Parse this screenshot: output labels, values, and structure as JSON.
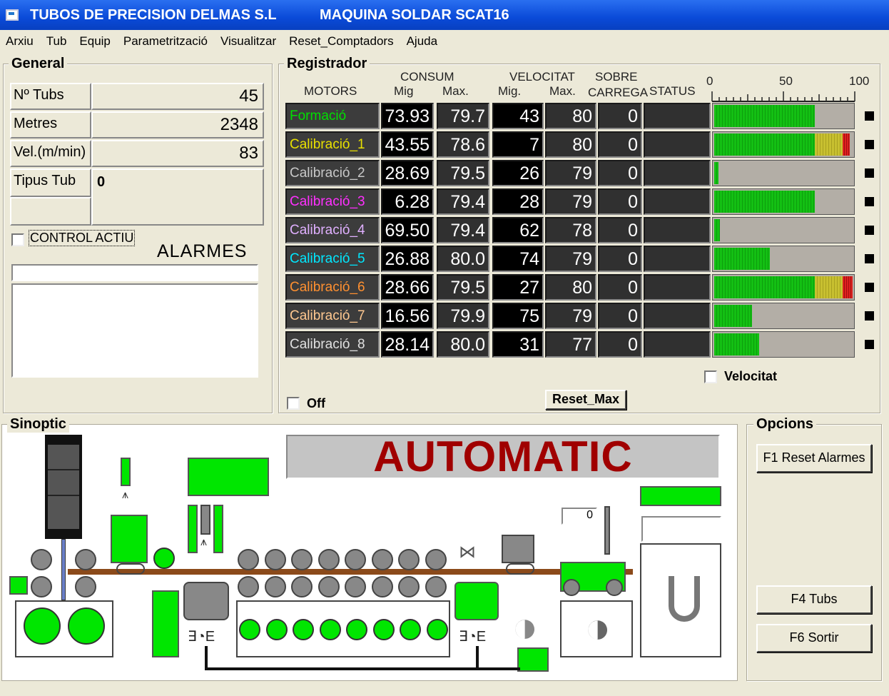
{
  "window": {
    "company": "TUBOS  DE PRECISION DELMAS S.L",
    "machine": "MAQUINA SOLDAR SCAT16"
  },
  "menu": [
    "Arxiu",
    "Tub",
    "Equip",
    "Parametrització",
    "Visualitzar",
    "Reset_Comptadors",
    "Ajuda"
  ],
  "general": {
    "legend": "General",
    "rows": [
      {
        "label": "Nº Tubs",
        "value": "45"
      },
      {
        "label": "Metres",
        "value": "2348"
      },
      {
        "label": "Vel.(m/min)",
        "value": "83"
      },
      {
        "label": "Tipus Tub",
        "value": "0"
      }
    ],
    "control_label": "CONTROL ACTIU",
    "alarms_title": "ALARMES"
  },
  "registrador": {
    "legend": "Registrador",
    "headers": {
      "motors": "MOTORS",
      "consum": "CONSUM",
      "consum_mig": "Mig",
      "consum_max": "Max.",
      "velocitat": "VELOCITAT",
      "vel_mig": "Mig.",
      "vel_max": "Max.",
      "sobre": "SOBRE",
      "carrega": "CARREGA",
      "status": "STATUS",
      "scale_0": "0",
      "scale_50": "50",
      "scale_100": "100"
    },
    "motors": [
      {
        "name": "Formació",
        "color": "#00e000",
        "consum_mig": "73.93",
        "consum_max": "79.7",
        "vel_mig": "43",
        "vel_max": "80",
        "sobre": "0",
        "load": 72,
        "yellow": 0,
        "red": 0
      },
      {
        "name": "Calibració_1",
        "color": "#e8e000",
        "consum_mig": "43.55",
        "consum_max": "78.6",
        "vel_mig": "7",
        "vel_max": "80",
        "sobre": "0",
        "load": 72,
        "yellow": 20,
        "red": 5
      },
      {
        "name": "Calibració_2",
        "color": "#c8c8c8",
        "consum_mig": "28.69",
        "consum_max": "79.5",
        "vel_mig": "26",
        "vel_max": "79",
        "sobre": "0",
        "load": 3,
        "yellow": 0,
        "red": 0
      },
      {
        "name": "Calibració_3",
        "color": "#ff30ff",
        "consum_mig": "6.28",
        "consum_max": "79.4",
        "vel_mig": "28",
        "vel_max": "79",
        "sobre": "0",
        "load": 72,
        "yellow": 0,
        "red": 0
      },
      {
        "name": "Calibració_4",
        "color": "#e0b0ff",
        "consum_mig": "69.50",
        "consum_max": "79.4",
        "vel_mig": "62",
        "vel_max": "78",
        "sobre": "0",
        "load": 4,
        "yellow": 0,
        "red": 0
      },
      {
        "name": "Calibració_5",
        "color": "#00e8ff",
        "consum_mig": "26.88",
        "consum_max": "80.0",
        "vel_mig": "74",
        "vel_max": "79",
        "sobre": "0",
        "load": 40,
        "yellow": 0,
        "red": 0
      },
      {
        "name": "Calibració_6",
        "color": "#ff9030",
        "consum_mig": "28.66",
        "consum_max": "79.5",
        "vel_mig": "27",
        "vel_max": "80",
        "sobre": "0",
        "load": 72,
        "yellow": 20,
        "red": 7
      },
      {
        "name": "Calibració_7",
        "color": "#ffc890",
        "consum_mig": "16.56",
        "consum_max": "79.9",
        "vel_mig": "75",
        "vel_max": "79",
        "sobre": "0",
        "load": 27,
        "yellow": 0,
        "red": 0
      },
      {
        "name": "Calibració_8",
        "color": "#e0e0e0",
        "consum_mig": "28.14",
        "consum_max": "80.0",
        "vel_mig": "31",
        "vel_max": "77",
        "sobre": "0",
        "load": 32,
        "yellow": 0,
        "red": 0
      }
    ],
    "velocitat_label": "Velocitat",
    "off_label": "Off",
    "reset_max": "Reset_Max"
  },
  "sinoptic": {
    "legend": "Sinoptic",
    "mode": "AUTOMATIC",
    "counter": "0"
  },
  "opcions": {
    "legend": "Opcions",
    "buttons": [
      "F1  Reset Alarmes",
      "F4 Tubs",
      "F6  Sortir"
    ]
  }
}
